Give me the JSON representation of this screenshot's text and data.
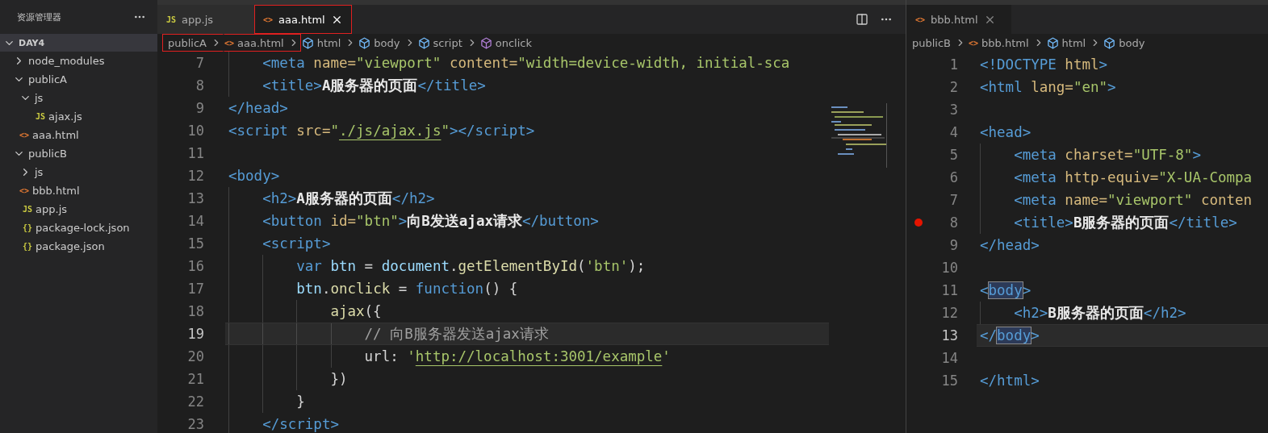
{
  "sidebar": {
    "title": "资源管理器",
    "root": {
      "label": "DAY4",
      "expanded": true
    },
    "items": [
      {
        "label": "node_modules",
        "kind": "folder",
        "expanded": false
      },
      {
        "label": "publicA",
        "kind": "folder",
        "expanded": true,
        "children": [
          {
            "label": "js",
            "kind": "folder",
            "expanded": true,
            "children": [
              {
                "label": "ajax.js",
                "kind": "js",
                "icon": "JS"
              }
            ]
          },
          {
            "label": "aaa.html",
            "kind": "html",
            "icon": "<>"
          }
        ]
      },
      {
        "label": "publicB",
        "kind": "folder",
        "expanded": true,
        "children": [
          {
            "label": "js",
            "kind": "folder",
            "expanded": false
          },
          {
            "label": "bbb.html",
            "kind": "html",
            "icon": "<>"
          }
        ]
      },
      {
        "label": "app.js",
        "kind": "js",
        "icon": "JS"
      },
      {
        "label": "package-lock.json",
        "kind": "json",
        "icon": "{}"
      },
      {
        "label": "package.json",
        "kind": "json",
        "icon": "{}"
      }
    ]
  },
  "groups": [
    {
      "tabs": [
        {
          "label": "app.js",
          "kind": "js",
          "icon": "JS",
          "selected": false,
          "closable": false,
          "marked": false
        },
        {
          "label": "aaa.html",
          "kind": "html",
          "icon": "<>",
          "selected": true,
          "closable": true,
          "marked": true
        }
      ],
      "actions": true,
      "minimap": true,
      "breadcrumb": [
        {
          "label": "publicA",
          "kind": "folder",
          "marked": true
        },
        {
          "label": "aaa.html",
          "kind": "file",
          "icon": "<>",
          "marked": true
        },
        {
          "label": "html",
          "kind": "element",
          "marked": false
        },
        {
          "label": "body",
          "kind": "element",
          "marked": false
        },
        {
          "label": "script",
          "kind": "element",
          "marked": false
        },
        {
          "label": "onclick",
          "kind": "method",
          "marked": false
        }
      ],
      "lines": [
        {
          "number": "7",
          "current": false,
          "breakpoint": false,
          "tokens": [
            {
              "kind": "tag",
              "text": "    <meta"
            },
            {
              "kind": "attr",
              "text": " name="
            },
            {
              "kind": "string",
              "text": "\"viewport\""
            },
            {
              "kind": "attr",
              "text": " content="
            },
            {
              "kind": "string",
              "text": "\"width=device-width, initial-sca"
            }
          ]
        },
        {
          "number": "8",
          "current": false,
          "breakpoint": false,
          "tokens": [
            {
              "kind": "tag",
              "text": "    <title>"
            },
            {
              "kind": "text",
              "text": "A服务器的页面"
            },
            {
              "kind": "tag",
              "text": "</title>"
            }
          ]
        },
        {
          "number": "9",
          "current": false,
          "breakpoint": false,
          "tokens": [
            {
              "kind": "tag",
              "text": "</head>"
            }
          ]
        },
        {
          "number": "10",
          "current": false,
          "breakpoint": false,
          "tokens": [
            {
              "kind": "tag",
              "text": "<script"
            },
            {
              "kind": "attr",
              "text": " src="
            },
            {
              "kind": "string",
              "text": "\""
            },
            {
              "kind": "link",
              "text": "./js/ajax.js"
            },
            {
              "kind": "string",
              "text": "\""
            },
            {
              "kind": "tag",
              "text": "></script>"
            }
          ]
        },
        {
          "number": "11",
          "current": false,
          "breakpoint": false
        },
        {
          "number": "12",
          "current": false,
          "breakpoint": false,
          "tokens": [
            {
              "kind": "tag",
              "text": "<body>"
            }
          ]
        },
        {
          "number": "13",
          "current": false,
          "breakpoint": false,
          "tokens": [
            {
              "kind": "tag",
              "text": "    <h2>"
            },
            {
              "kind": "text",
              "text": "A服务器的页面"
            },
            {
              "kind": "tag",
              "text": "</h2>"
            }
          ]
        },
        {
          "number": "14",
          "current": false,
          "breakpoint": false,
          "tokens": [
            {
              "kind": "tag",
              "text": "    <button"
            },
            {
              "kind": "attr",
              "text": " id="
            },
            {
              "kind": "string",
              "text": "\"btn\""
            },
            {
              "kind": "tag",
              "text": ">"
            },
            {
              "kind": "text",
              "text": "向B发送ajax请求"
            },
            {
              "kind": "tag",
              "text": "</button>"
            }
          ]
        },
        {
          "number": "15",
          "current": false,
          "breakpoint": false,
          "tokens": [
            {
              "kind": "tag",
              "text": "    <script>"
            }
          ]
        },
        {
          "number": "16",
          "current": false,
          "breakpoint": false,
          "tokens": [
            {
              "kind": "keyword",
              "text": "        var"
            },
            {
              "kind": "variable",
              "text": " btn"
            },
            {
              "kind": "plain",
              "text": " = "
            },
            {
              "kind": "variable",
              "text": "document"
            },
            {
              "kind": "plain",
              "text": "."
            },
            {
              "kind": "func",
              "text": "getElementById"
            },
            {
              "kind": "plain",
              "text": "("
            },
            {
              "kind": "string",
              "text": "'btn'"
            },
            {
              "kind": "plain",
              "text": ");"
            }
          ]
        },
        {
          "number": "17",
          "current": false,
          "breakpoint": false,
          "tokens": [
            {
              "kind": "variable",
              "text": "        btn"
            },
            {
              "kind": "plain",
              "text": "."
            },
            {
              "kind": "func",
              "text": "onclick"
            },
            {
              "kind": "plain",
              "text": " = "
            },
            {
              "kind": "keyword",
              "text": "function"
            },
            {
              "kind": "plain",
              "text": "() {"
            }
          ]
        },
        {
          "number": "18",
          "current": false,
          "breakpoint": false,
          "tokens": [
            {
              "kind": "func",
              "text": "            ajax"
            },
            {
              "kind": "plain",
              "text": "({"
            }
          ]
        },
        {
          "number": "19",
          "current": true,
          "breakpoint": false,
          "tokens": [
            {
              "kind": "comment",
              "text": "                // 向B服务器发送ajax请求"
            }
          ]
        },
        {
          "number": "20",
          "current": false,
          "breakpoint": false,
          "tokens": [
            {
              "kind": "plain",
              "text": "                url: "
            },
            {
              "kind": "string",
              "text": "'"
            },
            {
              "kind": "link",
              "text": "http://localhost:3001/example"
            },
            {
              "kind": "string",
              "text": "'"
            }
          ]
        },
        {
          "number": "21",
          "current": false,
          "breakpoint": false,
          "tokens": [
            {
              "kind": "plain",
              "text": "            })"
            }
          ]
        },
        {
          "number": "22",
          "current": false,
          "breakpoint": false,
          "tokens": [
            {
              "kind": "plain",
              "text": "        }"
            }
          ]
        },
        {
          "number": "23",
          "current": false,
          "breakpoint": false,
          "tokens": [
            {
              "kind": "tag",
              "text": "    </script>"
            }
          ]
        }
      ]
    },
    {
      "tabs": [
        {
          "label": "bbb.html",
          "kind": "html",
          "icon": "<>",
          "selected": true,
          "closable": true,
          "marked": false
        }
      ],
      "actions": false,
      "minimap": false,
      "breadcrumb": [
        {
          "label": "publicB",
          "kind": "folder",
          "marked": false
        },
        {
          "label": "bbb.html",
          "kind": "file",
          "icon": "<>",
          "marked": false
        },
        {
          "label": "html",
          "kind": "element",
          "marked": false
        },
        {
          "label": "body",
          "kind": "element",
          "marked": false
        }
      ],
      "lines": [
        {
          "number": "1",
          "current": false,
          "breakpoint": false,
          "tokens": [
            {
              "kind": "tag",
              "text": "<!DOCTYPE"
            },
            {
              "kind": "attr",
              "text": " html"
            },
            {
              "kind": "tag",
              "text": ">"
            }
          ]
        },
        {
          "number": "2",
          "current": false,
          "breakpoint": false,
          "tokens": [
            {
              "kind": "tag",
              "text": "<html"
            },
            {
              "kind": "attr",
              "text": " lang="
            },
            {
              "kind": "string",
              "text": "\"en\""
            },
            {
              "kind": "tag",
              "text": ">"
            }
          ]
        },
        {
          "number": "3",
          "current": false,
          "breakpoint": false
        },
        {
          "number": "4",
          "current": false,
          "breakpoint": false,
          "tokens": [
            {
              "kind": "tag",
              "text": "<head>"
            }
          ]
        },
        {
          "number": "5",
          "current": false,
          "breakpoint": false,
          "tokens": [
            {
              "kind": "tag",
              "text": "    <meta"
            },
            {
              "kind": "attr",
              "text": " charset="
            },
            {
              "kind": "string",
              "text": "\"UTF-8\""
            },
            {
              "kind": "tag",
              "text": ">"
            }
          ]
        },
        {
          "number": "6",
          "current": false,
          "breakpoint": false,
          "tokens": [
            {
              "kind": "tag",
              "text": "    <meta"
            },
            {
              "kind": "attr",
              "text": " http-equiv="
            },
            {
              "kind": "string",
              "text": "\"X-UA-Compa"
            }
          ]
        },
        {
          "number": "7",
          "current": false,
          "breakpoint": false,
          "tokens": [
            {
              "kind": "tag",
              "text": "    <meta"
            },
            {
              "kind": "attr",
              "text": " name="
            },
            {
              "kind": "string",
              "text": "\"viewport\""
            },
            {
              "kind": "attr",
              "text": " conten"
            }
          ]
        },
        {
          "number": "8",
          "current": false,
          "breakpoint": true,
          "tokens": [
            {
              "kind": "tag",
              "text": "    <title>"
            },
            {
              "kind": "text",
              "text": "B服务器的页面"
            },
            {
              "kind": "tag",
              "text": "</title>"
            }
          ]
        },
        {
          "number": "9",
          "current": false,
          "breakpoint": false,
          "tokens": [
            {
              "kind": "tag",
              "text": "</head>"
            }
          ]
        },
        {
          "number": "10",
          "current": false,
          "breakpoint": false
        },
        {
          "number": "11",
          "current": false,
          "breakpoint": false,
          "tokens": [
            {
              "kind": "tag",
              "text": "<"
            },
            {
              "kind": "match",
              "text": "body"
            },
            {
              "kind": "tag",
              "text": ">"
            }
          ]
        },
        {
          "number": "12",
          "current": false,
          "breakpoint": false,
          "tokens": [
            {
              "kind": "tag",
              "text": "    <h2>"
            },
            {
              "kind": "text",
              "text": "B服务器的页面"
            },
            {
              "kind": "tag",
              "text": "</h2>"
            }
          ]
        },
        {
          "number": "13",
          "current": true,
          "breakpoint": false,
          "tokens": [
            {
              "kind": "tag",
              "text": "</"
            },
            {
              "kind": "match",
              "text": "body"
            },
            {
              "kind": "tag",
              "text": ">"
            }
          ]
        },
        {
          "number": "14",
          "current": false,
          "breakpoint": false
        },
        {
          "number": "15",
          "current": false,
          "breakpoint": false,
          "tokens": [
            {
              "kind": "tag",
              "text": "</html>"
            }
          ]
        }
      ]
    }
  ]
}
